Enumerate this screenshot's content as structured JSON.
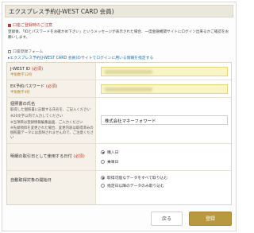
{
  "page": {
    "title": "エクスプレス予約(J-WEST CARD 会員)"
  },
  "notice": {
    "title": "口座ご登録時のご注意",
    "body": "登録後、「IDとパスワードをお確かめ下さい」というメッセージが表示された場合、一度金融機関サイトにログイン出来るかご確認をお願いします。"
  },
  "form_caption": "口座登録フォーム",
  "site_link": "エクスプレス予約(J-WEST CARD 会員)のサイトでログインに用いる情報を指定する",
  "fields": {
    "jwest_id": {
      "label": "J-WEST ID",
      "required": "(必須)",
      "note": "半角数字12桁"
    },
    "ex_password": {
      "label": "EX予約パスワード",
      "required": "(必須)",
      "note": "半角数字4桁"
    },
    "account_name": {
      "label": "個照書の氏名",
      "lines": [
        "取得した個照書に記載する氏名を、ご記入ください",
        "※20文字以内で入力してください",
        "※当項目は登録情報編集画面、ご入力ください",
        "※先頭項目を変更された場合、変更内容は取得済みの個照書データには反映されませんので、ご注意ください"
      ],
      "value": "株式会社マネーフォワード"
    },
    "date_setting": {
      "label": "明細の取引日として使用する日付",
      "required": "(必須)",
      "options": [
        "購入日",
        "乗車日"
      ],
      "selected": 0
    },
    "auto_fetch": {
      "label": "自動取得対象の開始日",
      "options": [
        "取得可能なデータをすべて取り込む",
        "指定日以降のデータのみ取り込む"
      ],
      "selected": 0
    }
  },
  "buttons": {
    "back": "戻る",
    "register": "登録"
  },
  "colors": {
    "accent": "#b8993f",
    "required": "#c0392b",
    "link": "#1a6fb5"
  }
}
